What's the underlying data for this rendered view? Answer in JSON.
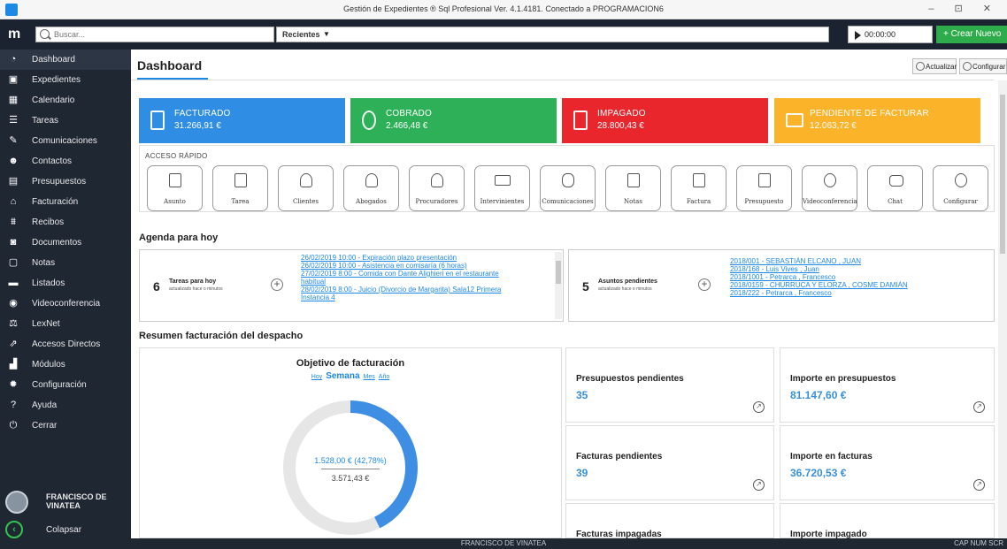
{
  "window": {
    "title": "Gestión de Expedientes ® Sql Profesional Ver. 4.1.4181. Conectado a PROGRAMACION6",
    "controls": "– ⊡ ✕"
  },
  "topbar": {
    "logo": "m",
    "search_placeholder": "Buscar...",
    "recent_label": "Recientes",
    "timer": "00:00:00",
    "create_label": "+ Crear Nuevo"
  },
  "sidebar": {
    "items": [
      {
        "label": "Dashboard",
        "icon": "dashboard-icon"
      },
      {
        "label": "Expedientes",
        "icon": "briefcase-icon"
      },
      {
        "label": "Calendario",
        "icon": "calendar-icon"
      },
      {
        "label": "Tareas",
        "icon": "tasks-icon"
      },
      {
        "label": "Comunicaciones",
        "icon": "communications-icon"
      },
      {
        "label": "Contactos",
        "icon": "contacts-icon"
      },
      {
        "label": "Presupuestos",
        "icon": "budget-icon"
      },
      {
        "label": "Facturación",
        "icon": "billing-icon"
      },
      {
        "label": "Recibos",
        "icon": "receipt-icon"
      },
      {
        "label": "Documentos",
        "icon": "documents-icon"
      },
      {
        "label": "Notas",
        "icon": "notes-icon"
      },
      {
        "label": "Listados",
        "icon": "listings-icon"
      },
      {
        "label": "Videoconferencia",
        "icon": "video-icon"
      },
      {
        "label": "LexNet",
        "icon": "lexnet-icon"
      },
      {
        "label": "Accesos Directos",
        "icon": "shortcuts-icon"
      },
      {
        "label": "Módulos",
        "icon": "modules-icon"
      },
      {
        "label": "Configuración",
        "icon": "gear-icon"
      },
      {
        "label": "Ayuda",
        "icon": "help-icon"
      },
      {
        "label": "Cerrar",
        "icon": "power-icon"
      }
    ],
    "user": "FRANCISCO DE VINATEA",
    "collapse_label": "Colapsar"
  },
  "main": {
    "title": "Dashboard",
    "refresh_label": "Actualizar",
    "configure_label": "Configurar",
    "cards": [
      {
        "label": "FACTURADO",
        "value": "31.266,91 €",
        "color": "#2f8de4"
      },
      {
        "label": "COBRADO",
        "value": "2.466,48 €",
        "color": "#2db057"
      },
      {
        "label": "IMPAGADO",
        "value": "28.800,43 €",
        "color": "#e8262b"
      },
      {
        "label": "PENDIENTE DE FACTURAR",
        "value": "12.063,72 €",
        "color": "#fbb42a"
      }
    ],
    "quick_title": "ACCESO RÁPIDO",
    "quick_items": [
      "Asunto",
      "Tarea",
      "Clientes",
      "Abogados",
      "Procuradores",
      "Intervinientes",
      "Comunicaciones",
      "Notas",
      "Factura",
      "Presupuesto",
      "Videoconferencia",
      "Chat",
      "Configurar"
    ],
    "agenda_title": "Agenda para hoy",
    "agenda_tasks": {
      "count": "6",
      "label": "Tareas para hoy",
      "sub": "actualizado hace o minutos",
      "items": [
        "26/02/2019 10:00 - Expiración plazo presentación",
        "26/02/2019 10:00 - Asistencia en comisaría (6 horas)",
        "27/02/2019 8:00 - Comida con Dante Alighieri en el restaurante",
        "habitual",
        "28/02/2019 8:00 - Juicio (Divorcio de Margarita) Sala12 Primera",
        "Instancia 4"
      ]
    },
    "agenda_matters": {
      "count": "5",
      "label": "Asuntos pendientes",
      "sub": "actualizado hace o minutos",
      "items": [
        "2018/001 - SEBASTIÁN ELCANO , JUAN",
        "2018/168 - Luis Vives , Juan",
        "2018/1001 - Petrarca , Francesco",
        "2018/0159 - CHURRUCA Y ELORZA , COSME DAMIÁN",
        "2018/222 - Petrarca , Francesco"
      ]
    },
    "billing_title": "Resumen facturación del despacho",
    "objective": {
      "title": "Objetivo de facturación",
      "tabs": [
        "Hoy",
        "Semana",
        "Mes",
        "Año"
      ],
      "achieved": "1.528,00 € (42,78%)",
      "target": "3.571,43 €",
      "progress": 0.4278
    },
    "stats": [
      {
        "label": "Presupuestos pendientes",
        "value": "35"
      },
      {
        "label": "Importe en presupuestos",
        "value": "81.147,60 €"
      },
      {
        "label": "Facturas pendientes",
        "value": "39"
      },
      {
        "label": "Importe en facturas",
        "value": "36.720,53 €"
      },
      {
        "label": "Facturas impagadas",
        "value": ""
      },
      {
        "label": "Importe impagado",
        "value": ""
      }
    ]
  },
  "status": {
    "center": "FRANCISCO DE VINATEA",
    "right": "CAP  NUM  SCR"
  }
}
